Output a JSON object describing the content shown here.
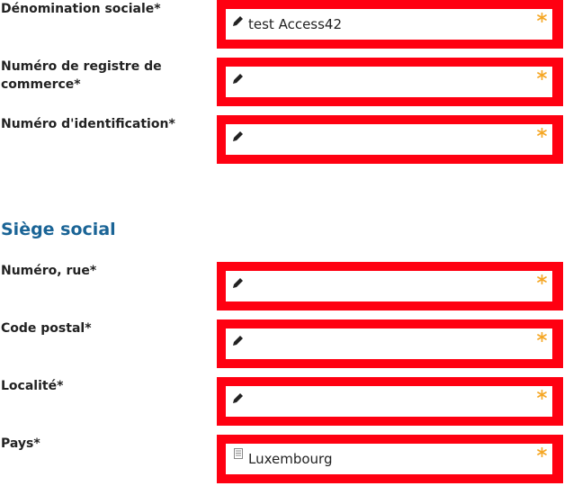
{
  "form": {
    "fields": [
      {
        "label": "Dénomination sociale*",
        "value": "test Access42",
        "icon": "pencil-icon",
        "required_icon": "asterisk-icon"
      },
      {
        "label": "Numéro de registre de commerce*",
        "value": "",
        "icon": "pencil-icon",
        "required_icon": "asterisk-icon"
      },
      {
        "label": "Numéro d'identification*",
        "value": "",
        "icon": "pencil-icon",
        "required_icon": "asterisk-icon"
      }
    ],
    "section_title": "Siège social",
    "address_fields": [
      {
        "label": "Numéro, rue*",
        "value": "",
        "icon": "pencil-icon",
        "required_icon": "asterisk-icon"
      },
      {
        "label": "Code postal*",
        "value": "",
        "icon": "pencil-icon",
        "required_icon": "asterisk-icon"
      },
      {
        "label": "Localité*",
        "value": "",
        "icon": "pencil-icon",
        "required_icon": "asterisk-icon"
      },
      {
        "label": "Pays*",
        "value": "Luxembourg",
        "icon": "list-icon",
        "required_icon": "asterisk-icon"
      }
    ]
  },
  "colors": {
    "error_border": "#ff0011",
    "section_title": "#1a6496",
    "required_asterisk": "#f5a623",
    "label_text": "#222222"
  }
}
